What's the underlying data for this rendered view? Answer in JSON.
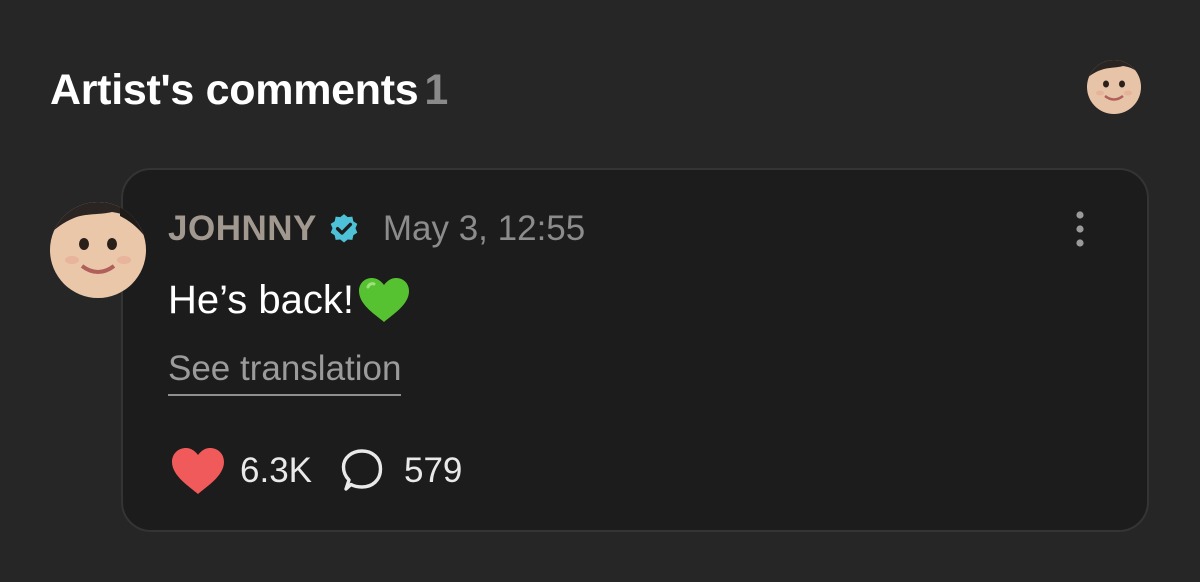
{
  "header": {
    "title": "Artist's comments",
    "count": "1"
  },
  "comment": {
    "author": "JOHNNY",
    "timestamp": "May 3, 12:55",
    "message": "He’s back!",
    "see_translation": "See translation",
    "likes": "6.3K",
    "replies": "579"
  },
  "icons": {
    "verified": "verified-badge-icon",
    "more": "more-vertical-icon",
    "emoji": "green-heart-icon",
    "like": "heart-icon",
    "reply": "speech-bubble-icon"
  },
  "colors": {
    "background": "#262626",
    "card": "#1c1c1c",
    "author": "#a1998f",
    "verified": "#4ec0d7",
    "like": "#f15a5a",
    "emoji": "#56c232"
  }
}
